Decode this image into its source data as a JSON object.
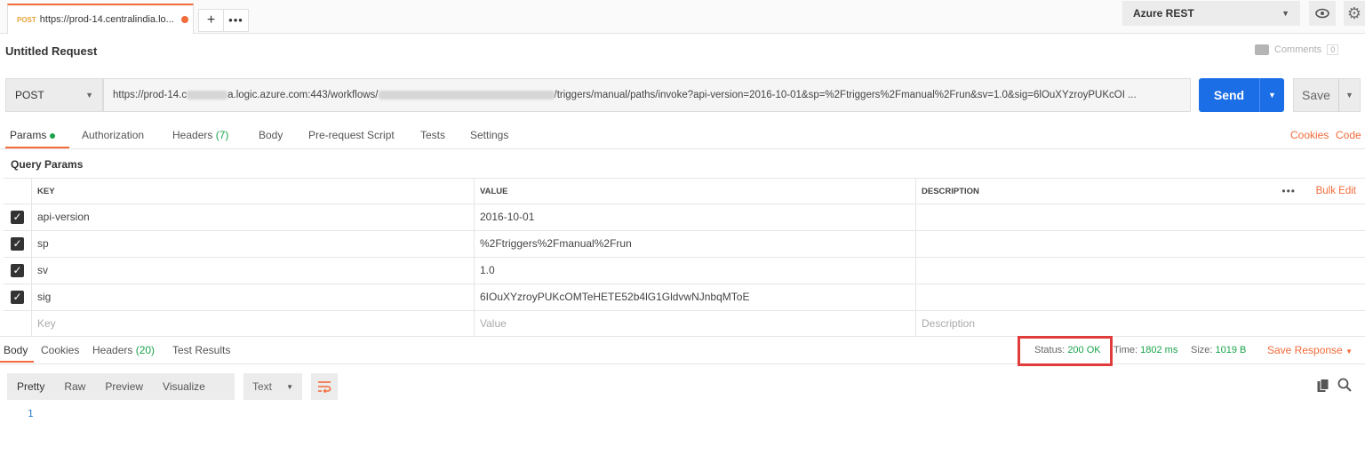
{
  "tab": {
    "method": "POST",
    "url": "https://prod-14.centralindia.lo...",
    "add_label": "+",
    "more_label": "•••"
  },
  "environment": {
    "selected": "Azure REST"
  },
  "request": {
    "title": "Untitled Request",
    "comments_label": "Comments",
    "comments_count": "0",
    "method": "POST",
    "url_prefix": "https://prod-14.c",
    "url_mid": "a.logic.azure.com:443/workflows/",
    "url_suffix": "/triggers/manual/paths/invoke?api-version=2016-10-01&sp=%2Ftriggers%2Fmanual%2Frun&sv=1.0&sig=6lOuXYzroyPUKcOI ...",
    "send_label": "Send",
    "save_label": "Save"
  },
  "request_tabs": {
    "params": "Params",
    "authorization": "Authorization",
    "headers": "Headers",
    "headers_count": "(7)",
    "body": "Body",
    "prerequest": "Pre-request Script",
    "tests": "Tests",
    "settings": "Settings",
    "cookies": "Cookies",
    "code": "Code"
  },
  "query_params": {
    "title": "Query Params",
    "headers": {
      "key": "KEY",
      "value": "VALUE",
      "description": "DESCRIPTION"
    },
    "bulk_more": "•••",
    "bulk_edit": "Bulk Edit",
    "rows": [
      {
        "key": "api-version",
        "value": "2016-10-01"
      },
      {
        "key": "sp",
        "value": "%2Ftriggers%2Fmanual%2Frun"
      },
      {
        "key": "sv",
        "value": "1.0"
      },
      {
        "key": "sig",
        "value": "6IOuXYzroyPUKcOMTeHETE52b4lG1GldvwNJnbqMToE"
      }
    ],
    "placeholder": {
      "key": "Key",
      "value": "Value",
      "description": "Description"
    }
  },
  "response": {
    "tabs": {
      "body": "Body",
      "cookies": "Cookies",
      "headers": "Headers",
      "headers_count": "(20)",
      "test_results": "Test Results"
    },
    "status_label": "Status:",
    "status_value": "200 OK",
    "time_label": "Time:",
    "time_value": "1802 ms",
    "size_label": "Size:",
    "size_value": "1019 B",
    "save_response": "Save Response",
    "formats": {
      "pretty": "Pretty",
      "raw": "Raw",
      "preview": "Preview",
      "visualize": "Visualize"
    },
    "language": "Text",
    "line_number": "1"
  },
  "colors": {
    "accent": "#f26b3a",
    "send": "#1b6ee6",
    "success": "#1aa34a",
    "highlight_box": "#e03c3c"
  }
}
